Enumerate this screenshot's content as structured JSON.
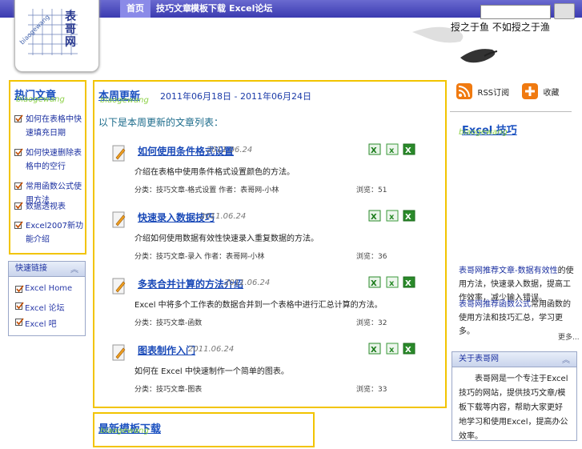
{
  "header": {
    "logo_text": "表哥网",
    "logo_sub": "biaogewang",
    "nav": [
      "首页",
      "技巧文章",
      "模板下载",
      "Excel论坛"
    ],
    "motto": "授之于鱼  不如授之于渔"
  },
  "left": {
    "title": "热门文章",
    "watermark": "biaogewang",
    "items": [
      "如何在表格中快速填充日期",
      "如何快速删除表格中的空行",
      "常用函数公式使用方法",
      "数据透视表",
      "Excel2007新功能介绍"
    ],
    "tools_title": "快速链接",
    "tools": [
      "Excel Home",
      "Excel 论坛",
      "Excel 吧"
    ]
  },
  "main": {
    "title": "本周更新",
    "watermark": "biaogewang",
    "date_range": "2011年06月18日 - 2011年06月24日",
    "subtitle": "以下是本周更新的文章列表：",
    "posts": [
      {
        "title": "如何使用条件格式设置",
        "date": "2011.06.24",
        "desc": "介绍在表格中使用条件格式设置颜色的方法。",
        "meta": "分类：技巧文章-格式设置  作者：表哥网-小林",
        "views": "浏览：51"
      },
      {
        "title": "快速录入数据技巧",
        "date": "2011.06.24",
        "desc": "介绍如何使用数据有效性快速录入重复数据的方法。",
        "meta": "分类：技巧文章-录入  作者：表哥网-小林",
        "views": "浏览：36"
      },
      {
        "title": "多表合并计算的方法介绍",
        "date": "2011.06.24",
        "desc": "Excel 中将多个工作表的数据合并到一个表格中进行汇总计算的方法。",
        "meta": "分类：技巧文章-函数",
        "views": "浏览：32"
      },
      {
        "title": "图表制作入门",
        "date": "2011.06.24",
        "desc": "如何在 Excel 中快速制作一个简单的图表。",
        "meta": "分类：技巧文章-图表",
        "views": "浏览：33"
      }
    ]
  },
  "bottom": {
    "title": "最新模板下载",
    "watermark": "biaogewang"
  },
  "right": {
    "rss_label": "RSS订阅",
    "fav_label": "收藏",
    "excel_title": "Excel 技巧",
    "watermark": "biaogewang",
    "para1_link": "表哥网推荐文章-数据有效性",
    "para1_text": "的使用方法，快速录入数据，提高工作效率，减少输入错误。",
    "para2_link": "表哥网推荐函数公式",
    "para2_text": "常用函数的使用方法和技巧汇总，学习更多。",
    "more": "更多...",
    "panel_title": "关于表哥网",
    "panel_text": "表哥网是一个专注于Excel技巧的网站，提供技巧文章/模板下载等内容，帮助大家更好地学习和使用Excel，提高办公效率。"
  },
  "colors": {
    "nav_bg": "#3a3ab0",
    "box_border": "#f2c400",
    "link": "#1a2fa0"
  }
}
